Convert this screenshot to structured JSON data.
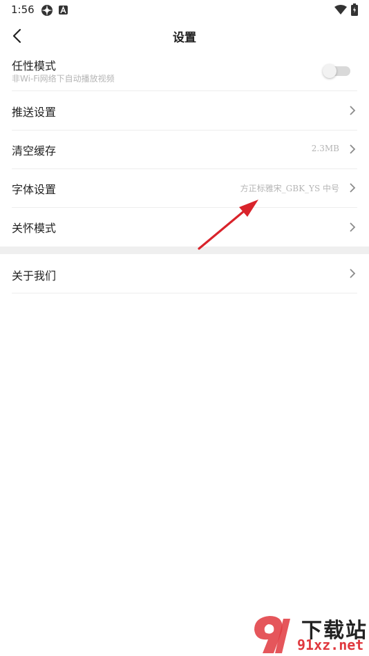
{
  "status_bar": {
    "time": "1:56",
    "icons": [
      "settings-app-icon",
      "a-badge-icon",
      "wifi-icon",
      "battery-icon"
    ]
  },
  "header": {
    "title": "设置",
    "back_icon": "chevron-left-icon"
  },
  "settings": [
    {
      "label": "任性模式",
      "sublabel": "非Wi-Fi网络下自动播放视频",
      "type": "toggle",
      "enabled": false
    },
    {
      "label": "推送设置",
      "type": "link"
    },
    {
      "label": "清空缓存",
      "value": "2.3MB",
      "type": "link"
    },
    {
      "label": "字体设置",
      "value": "方正标雅宋_GBK_YS 中号",
      "type": "link"
    },
    {
      "label": "关怀模式",
      "type": "link"
    },
    {
      "label": "关于我们",
      "type": "link"
    }
  ],
  "watermark": {
    "logo_text": "下载站",
    "site": "91xz.net"
  },
  "colors": {
    "text": "#222222",
    "secondary_text": "#b5b5b5",
    "divider": "#ededed",
    "section_band": "#efefef",
    "annotation_arrow": "#d9232b",
    "watermark_red": "#e0383e"
  }
}
